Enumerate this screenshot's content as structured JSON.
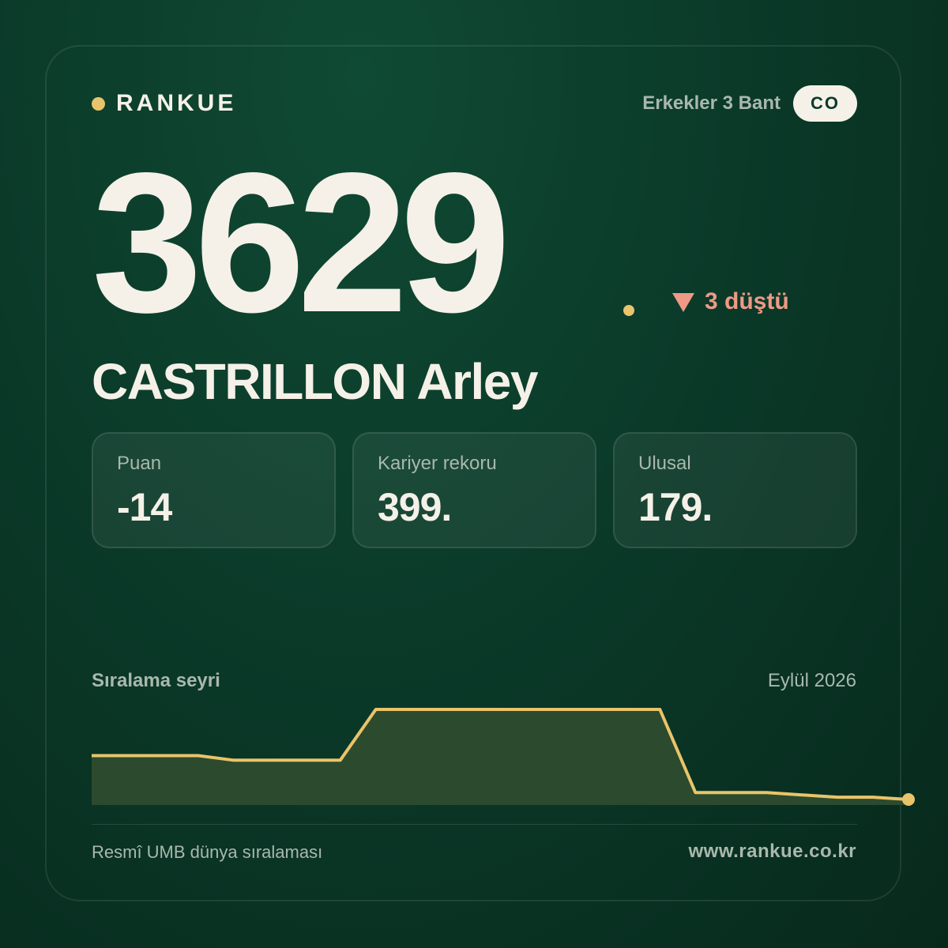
{
  "brand": {
    "name": "RANKUE",
    "accent": "#e9c46a"
  },
  "header": {
    "category": "Erkekler 3 Bant",
    "country_code": "CO"
  },
  "rank": {
    "value": "3629",
    "change_text": "3 düştü",
    "change_color": "#ee9a86"
  },
  "player": {
    "name": "CASTRILLON Arley"
  },
  "stats": [
    {
      "label": "Puan",
      "value": "-14"
    },
    {
      "label": "Kariyer rekoru",
      "value": "399."
    },
    {
      "label": "Ulusal",
      "value": "179."
    }
  ],
  "trend": {
    "title": "Sıralama seyri",
    "date": "Eylül 2026"
  },
  "chart_data": {
    "type": "area",
    "title": "Sıralama seyri",
    "y_reversed": true,
    "line_color": "#e9c46a",
    "fill_color": "#2c4a2e",
    "x_index": [
      0,
      1,
      2,
      3,
      4,
      5,
      6,
      7,
      8,
      9,
      10,
      11,
      12,
      13,
      14,
      15,
      16,
      17,
      18,
      19,
      20,
      21,
      22,
      23
    ],
    "values": [
      3610,
      3610,
      3610,
      3610,
      3612,
      3612,
      3612,
      3612,
      3590,
      3590,
      3590,
      3590,
      3590,
      3590,
      3590,
      3590,
      3590,
      3626,
      3626,
      3626,
      3627,
      3628,
      3628,
      3629
    ]
  },
  "footer": {
    "source": "Resmî UMB dünya sıralaması",
    "url": "www.rankue.co.kr"
  }
}
